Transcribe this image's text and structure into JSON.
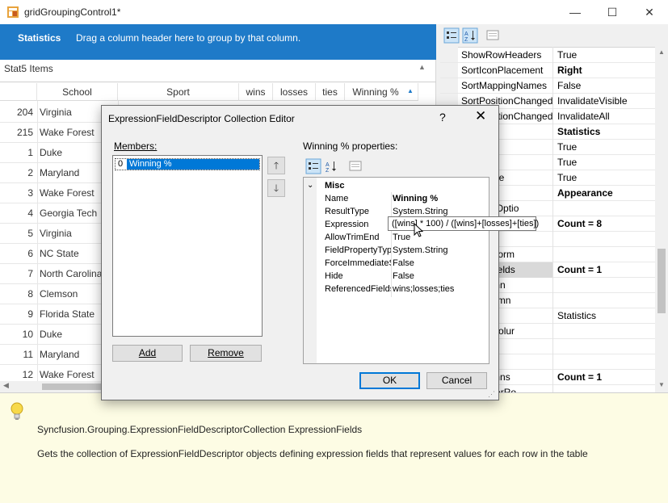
{
  "window": {
    "title": "gridGroupingControl1*",
    "minimize": "—",
    "maximize": "☐",
    "close": "✕"
  },
  "grid": {
    "group_label": "Statistics",
    "group_hint": "Drag a column header here to group by that column.",
    "record_count": "Stat5 Items",
    "columns": [
      "School",
      "Sport",
      "wins",
      "losses",
      "ties",
      "Winning %"
    ],
    "rows": [
      {
        "num": "204",
        "school": "Virginia"
      },
      {
        "num": "215",
        "school": "Wake Forest"
      },
      {
        "num": "1",
        "school": "Duke"
      },
      {
        "num": "2",
        "school": "Maryland"
      },
      {
        "num": "3",
        "school": "Wake Forest"
      },
      {
        "num": "4",
        "school": "Georgia Tech"
      },
      {
        "num": "5",
        "school": "Virginia"
      },
      {
        "num": "6",
        "school": "NC State"
      },
      {
        "num": "7",
        "school": "North Carolina"
      },
      {
        "num": "8",
        "school": "Clemson"
      },
      {
        "num": "9",
        "school": "Florida State"
      },
      {
        "num": "10",
        "school": "Duke"
      },
      {
        "num": "11",
        "school": "Maryland"
      },
      {
        "num": "12",
        "school": "Wake Forest"
      }
    ]
  },
  "property_grid": {
    "rows": [
      {
        "name": "ShowRowHeaders",
        "value": "True",
        "bold": false
      },
      {
        "name": "SortIconPlacement",
        "value": "Right",
        "bold": true
      },
      {
        "name": "SortMappingNames",
        "value": "False",
        "bold": false
      },
      {
        "name": "SortPositionChanged",
        "value": "InvalidateVisible",
        "bold": false
      },
      {
        "name": "SortPositionChanged",
        "value": "InvalidateAll",
        "bold": false
      },
      {
        "name": "scriptor",
        "value": "Statistics",
        "bold": true
      },
      {
        "name": "wEdit",
        "value": "True",
        "bold": false
      },
      {
        "name": "wNew",
        "value": "True",
        "bold": false
      },
      {
        "name": "wRemove",
        "value": "True",
        "bold": false
      },
      {
        "name": "earance",
        "value": "Appearance",
        "bold": true
      },
      {
        "name": "ldGroupOptio",
        "value": "",
        "bold": false
      },
      {
        "name": "",
        "value": "Count = 8",
        "bold": true
      },
      {
        "name": "mnSets",
        "value": "",
        "bold": false
      },
      {
        "name": "ditionalForm",
        "value": "",
        "bold": false
      },
      {
        "name": "essionFields",
        "value": "Count = 1",
        "bold": true
      },
      {
        "name": "enColumn",
        "value": "",
        "bold": false
      },
      {
        "name": "pedColumn",
        "value": "",
        "bold": false
      },
      {
        "name": "e",
        "value": "Statistics",
        "bold": false
      },
      {
        "name": "aryKeyColur",
        "value": "",
        "bold": false
      },
      {
        "name": "rdFilters",
        "value": "",
        "bold": false
      },
      {
        "name": "ions",
        "value": "",
        "bold": false
      },
      {
        "name": "edColumns",
        "value": "Count = 1",
        "bold": true
      },
      {
        "name": "edHeaderRo",
        "value": "",
        "bold": false
      }
    ]
  },
  "help": {
    "title": "Syncfusion.Grouping.ExpressionFieldDescriptorCollection ExpressionFields",
    "description": "Gets the collection of ExpressionFieldDescriptor objects defining expression fields that represent values for each row in the table"
  },
  "dialog": {
    "title": "ExpressionFieldDescriptor Collection Editor",
    "help": "?",
    "close": "✕",
    "members_label": "Members:",
    "member_index": "0",
    "member_name": "Winning %",
    "properties_label": "Winning % properties:",
    "category": "Misc",
    "properties": [
      {
        "name": "Name",
        "value": "Winning %",
        "bold": true
      },
      {
        "name": "ResultType",
        "value": "System.String",
        "bold": false
      },
      {
        "name": "Expression",
        "value": "",
        "bold": false
      },
      {
        "name": "AllowTrimEnd",
        "value": "True",
        "bold": false
      },
      {
        "name": "FieldPropertyTyp",
        "value": "System.String",
        "bold": false
      },
      {
        "name": "ForceImmediateS",
        "value": "False",
        "bold": false
      },
      {
        "name": "Hide",
        "value": "False",
        "bold": false
      },
      {
        "name": "ReferencedFields",
        "value": "wins;losses;ties",
        "bold": false
      }
    ],
    "tooltip": "([wins] * 100) / ([wins]+[losses]+[ties])",
    "add": "Add",
    "remove": "Remove",
    "ok": "OK",
    "cancel": "Cancel"
  },
  "colors": {
    "accent": "#1e7ac8",
    "selection": "#0078d7",
    "help_bg": "#fdfce4"
  }
}
